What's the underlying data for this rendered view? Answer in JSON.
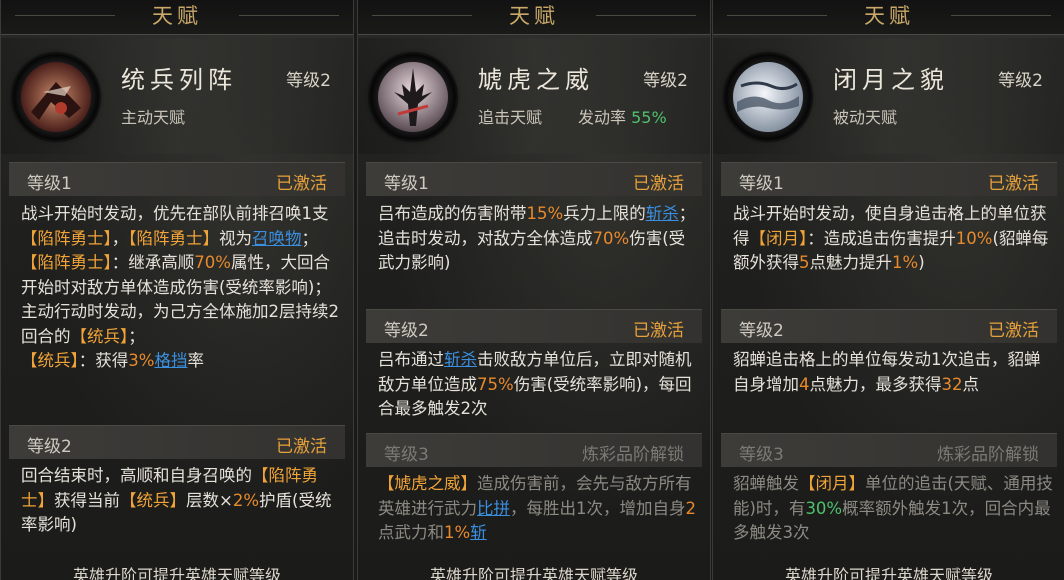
{
  "panels": [
    {
      "header_title": "天赋",
      "skill_name": "统兵列阵",
      "level": "等级2",
      "type": "主动天赋",
      "levels": [
        {
          "name": "等级1",
          "status": "已激活"
        },
        {
          "name": "等级2",
          "status": "已激活"
        }
      ],
      "desc1": [
        {
          "t": "战斗开始时发动，优先在部队前排召唤1支"
        },
        {
          "t": "【陷阵勇士】",
          "c": "orange"
        },
        {
          "t": "，"
        },
        {
          "t": "【陷阵勇士】",
          "c": "orange"
        },
        {
          "t": "视为"
        },
        {
          "t": "召唤物",
          "c": "link"
        },
        {
          "t": "；\n"
        },
        {
          "t": "【陷阵勇士】",
          "c": "orange"
        },
        {
          "t": "：继承高顺"
        },
        {
          "t": "70%",
          "c": "hl-orange"
        },
        {
          "t": "属性，大回合开始时对敌方单体造成伤害(受统率影响)；\n主动行动时发动，为己方全体施加2层持续2回合的"
        },
        {
          "t": "【统兵】",
          "c": "orange"
        },
        {
          "t": "；\n"
        },
        {
          "t": "【统兵】",
          "c": "orange"
        },
        {
          "t": "：获得"
        },
        {
          "t": "3%",
          "c": "hl-orange"
        },
        {
          "t": "格挡",
          "c": "link"
        },
        {
          "t": "率"
        }
      ],
      "desc2": [
        {
          "t": "回合结束时，高顺和自身召唤的"
        },
        {
          "t": "【陷阵勇士】",
          "c": "orange"
        },
        {
          "t": "获得当前"
        },
        {
          "t": "【统兵】",
          "c": "orange"
        },
        {
          "t": "层数×"
        },
        {
          "t": "2%",
          "c": "hl-orange"
        },
        {
          "t": "护盾(受统率影响)"
        }
      ],
      "footer": "英雄升阶可提升英雄天赋等级"
    },
    {
      "header_title": "天赋",
      "skill_name": "虓虎之威",
      "level": "等级2",
      "type": "追击天赋",
      "rate_label": "发动率",
      "rate_value": "55%",
      "levels": [
        {
          "name": "等级1",
          "status": "已激活"
        },
        {
          "name": "等级2",
          "status": "已激活"
        },
        {
          "name": "等级3",
          "status": "炼彩品阶解锁"
        }
      ],
      "desc1": [
        {
          "t": "吕布造成的伤害附带"
        },
        {
          "t": "15%",
          "c": "hl-orange"
        },
        {
          "t": "兵力上限的"
        },
        {
          "t": "斩杀",
          "c": "link"
        },
        {
          "t": "；\n追击时发动，对敌方全体造成"
        },
        {
          "t": "70%",
          "c": "hl-orange"
        },
        {
          "t": "伤害(受武力影响)"
        }
      ],
      "desc2": [
        {
          "t": "吕布通过"
        },
        {
          "t": "斩杀",
          "c": "link"
        },
        {
          "t": "击败敌方单位后，立即对随机敌方单位造成"
        },
        {
          "t": "75%",
          "c": "hl-orange"
        },
        {
          "t": "伤害(受统率影响)，每回合最多触发2次"
        }
      ],
      "desc3": [
        {
          "t": "【虓虎之威】",
          "c": "orange"
        },
        {
          "t": "造成伤害前，会先与敌方所有英雄进行武力"
        },
        {
          "t": "比拼",
          "c": "link"
        },
        {
          "t": "，每胜出1次，增加自身"
        },
        {
          "t": "2",
          "c": "hl-orange"
        },
        {
          "t": "点武力和"
        },
        {
          "t": "1%",
          "c": "hl-orange"
        },
        {
          "t": "斩",
          "c": "link"
        }
      ],
      "footer": "英雄升阶可提升英雄天赋等级"
    },
    {
      "header_title": "天赋",
      "skill_name": "闭月之貌",
      "level": "等级2",
      "type": "被动天赋",
      "levels": [
        {
          "name": "等级1",
          "status": "已激活"
        },
        {
          "name": "等级2",
          "status": "已激活"
        },
        {
          "name": "等级3",
          "status": "炼彩品阶解锁"
        }
      ],
      "desc1": [
        {
          "t": "战斗开始时发动，使自身追击格上的单位获得"
        },
        {
          "t": "【闭月】",
          "c": "orange"
        },
        {
          "t": "：造成追击伤害提升"
        },
        {
          "t": "10%",
          "c": "hl-orange"
        },
        {
          "t": "(貂蝉每额外获得"
        },
        {
          "t": "5",
          "c": "hl-orange"
        },
        {
          "t": "点魅力提升"
        },
        {
          "t": "1%",
          "c": "hl-orange"
        },
        {
          "t": ")"
        }
      ],
      "desc2": [
        {
          "t": "貂蝉追击格上的单位每发动1次追击，貂蝉自身增加"
        },
        {
          "t": "4",
          "c": "hl-orange"
        },
        {
          "t": "点魅力，最多获得"
        },
        {
          "t": "32",
          "c": "hl-orange"
        },
        {
          "t": "点"
        }
      ],
      "desc3": [
        {
          "t": "貂蝉触发"
        },
        {
          "t": "【闭月】",
          "c": "orange"
        },
        {
          "t": "单位的追击(天赋、通用技能)时，有"
        },
        {
          "t": "30%",
          "c": "hl-green"
        },
        {
          "t": "概率额外触发1次，回合内最多触发3次"
        }
      ],
      "footer": "英雄升阶可提升英雄天赋等级"
    }
  ],
  "icons": [
    "skill-icon-tongbing",
    "skill-icon-xiaohu",
    "skill-icon-biyue"
  ]
}
